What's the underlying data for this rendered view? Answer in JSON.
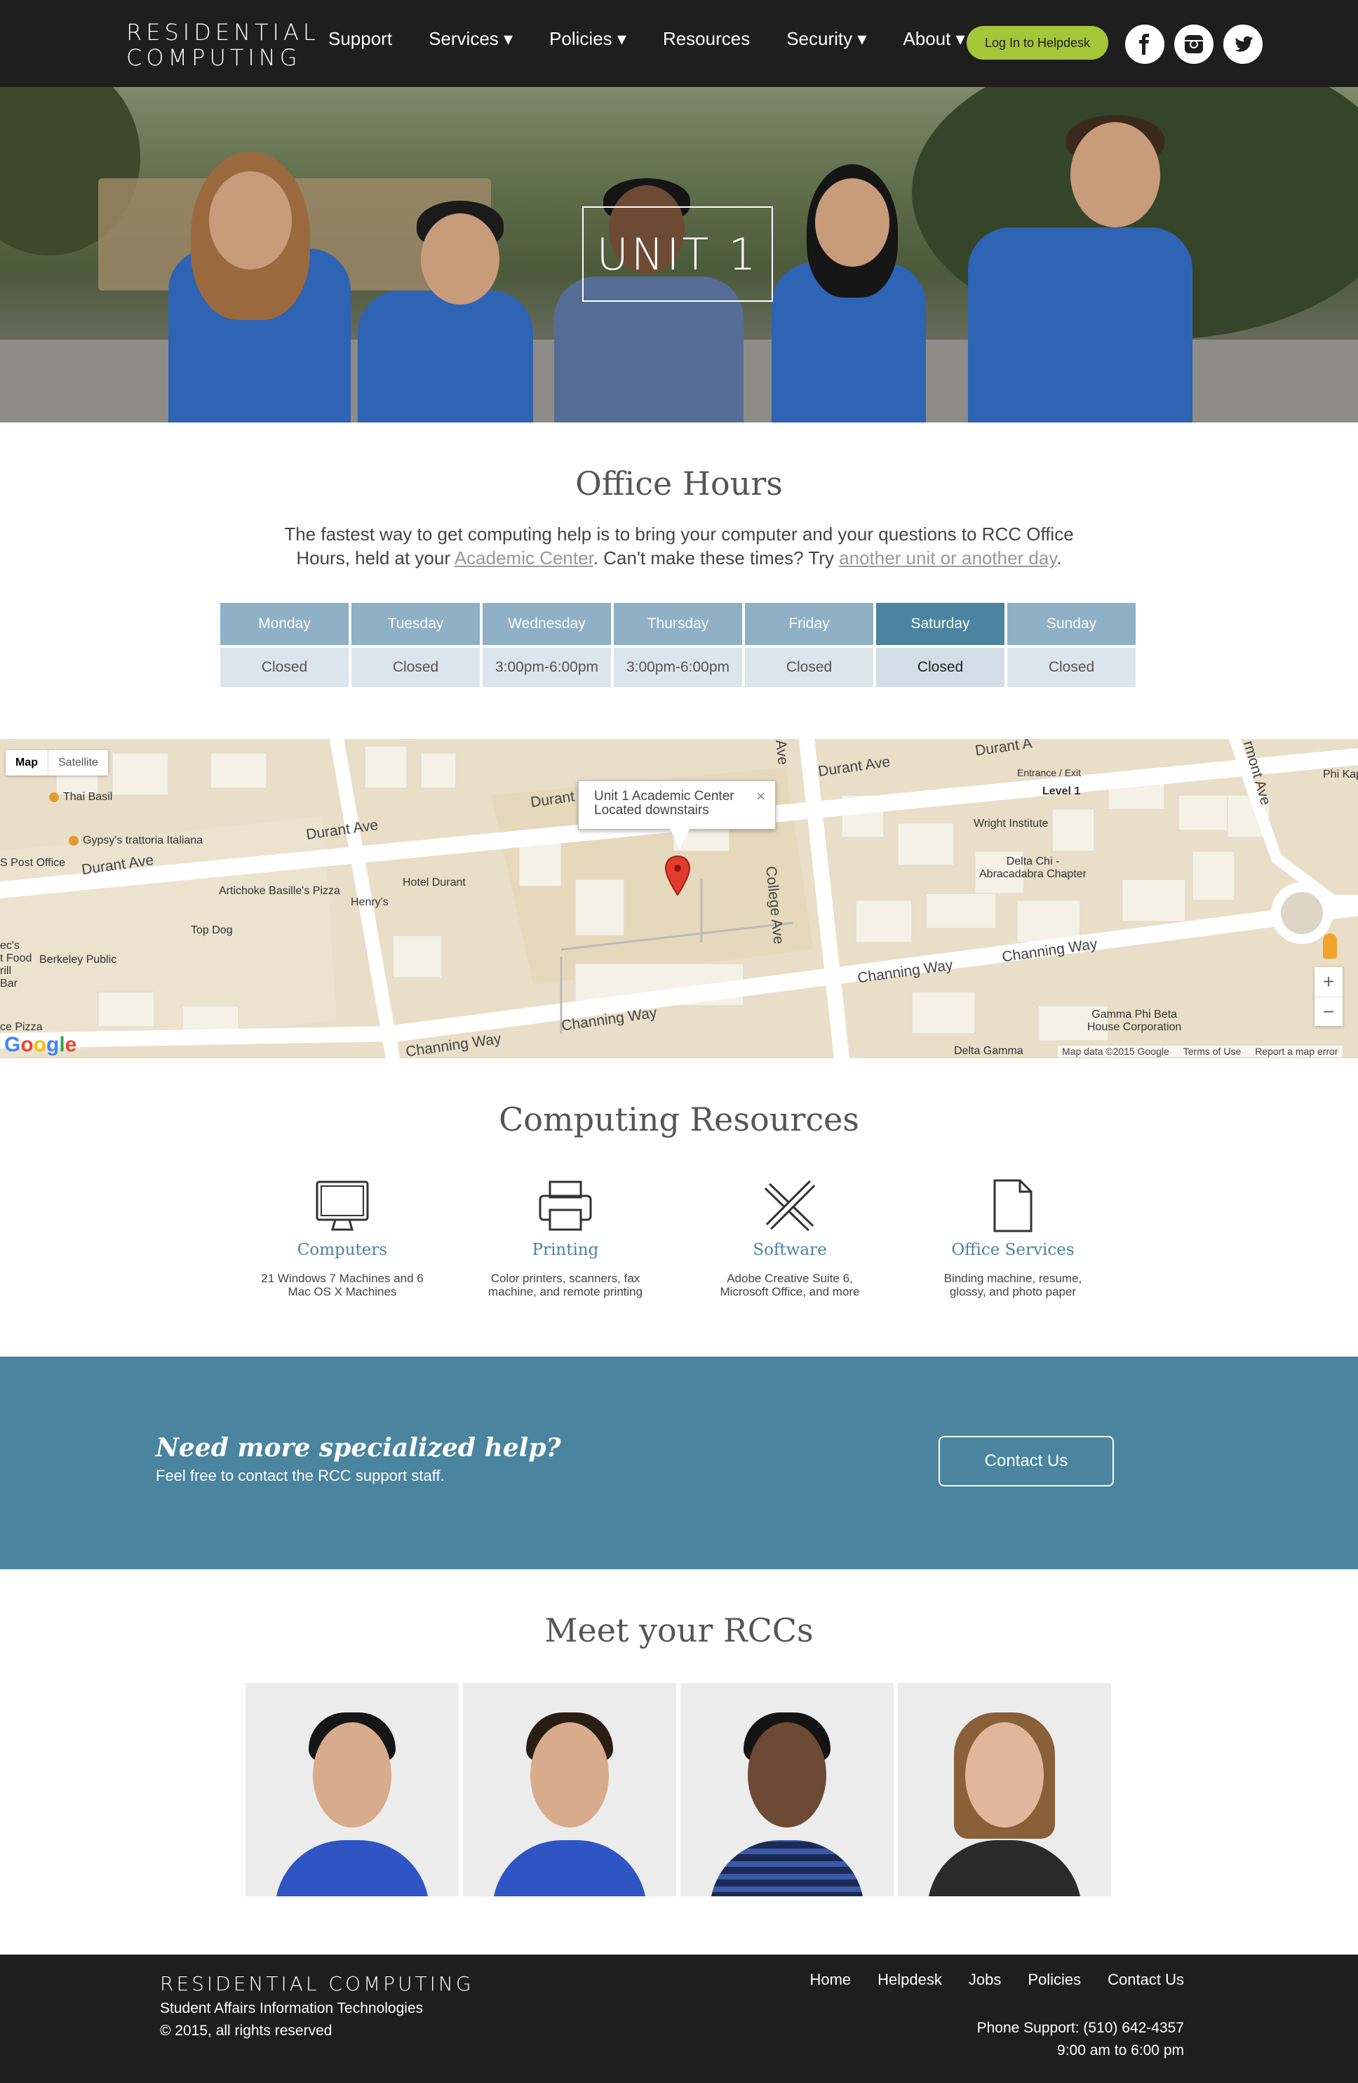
{
  "nav": {
    "logo_line1": "RESIDENTIAL",
    "logo_line2": "COMPUTING",
    "links": [
      "Support",
      "Services ▾",
      "Policies ▾",
      "Resources",
      "Security ▾",
      "About ▾"
    ],
    "helpdesk_label": "Log In to Helpdesk",
    "social": [
      "facebook-icon",
      "instagram-icon",
      "twitter-icon"
    ]
  },
  "hero": {
    "title": "UNIT 1"
  },
  "office_hours": {
    "title": "Office Hours",
    "desc_1": "The fastest way to get computing help is to bring your computer and your questions to RCC Office Hours, held at your ",
    "link_1": "Academic Center",
    "desc_2": ". Can't make these times? Try ",
    "link_2": "another unit or another day",
    "desc_3": ".",
    "days": [
      {
        "name": "Monday",
        "value": "Closed"
      },
      {
        "name": "Tuesday",
        "value": "Closed"
      },
      {
        "name": "Wednesday",
        "value": "3:00pm-6:00pm"
      },
      {
        "name": "Thursday",
        "value": "3:00pm-6:00pm"
      },
      {
        "name": "Friday",
        "value": "Closed"
      },
      {
        "name": "Saturday",
        "value": "Closed"
      },
      {
        "name": "Sunday",
        "value": "Closed"
      }
    ],
    "active_day": "Saturday"
  },
  "map": {
    "type_map": "Map",
    "type_satellite": "Satellite",
    "info_line1": "Unit 1 Academic Center",
    "info_line2": "Located downstairs",
    "close": "×",
    "zoom_in": "+",
    "zoom_out": "−",
    "google": "Google",
    "data_credit": "Map data ©2015 Google",
    "terms": "Terms of Use",
    "report": "Report a map error",
    "roads": {
      "durant_1": "Durant Ave",
      "durant_2": "Durant Ave",
      "durant_3": "Durant Ave",
      "durant_4": "Durant Ave",
      "durant_5": "Durant A",
      "college": "College Ave",
      "channing_1": "Channing Way",
      "channing_2": "Channing Way",
      "channing_3": "Channing Way",
      "channing_4": "Channing Way",
      "ave_top": "Ave",
      "bowditch": "rmont Ave"
    },
    "pois": {
      "thai_basil": "Thai Basil",
      "gypsys": "Gypsy's trattoria Italiana",
      "post_office": "S Post Office",
      "artichoke": "Artichoke Basille's Pizza",
      "henrys": "Henry's",
      "hotel_durant": "Hotel Durant",
      "top_dog": "Top Dog",
      "berkeley_public": "Berkeley Public",
      "ecs_food": "ec's\nt Food\nrill\nBar",
      "ce_pizza": "ce Pizza",
      "entrance": "Entrance / Exit",
      "level1": "Level 1",
      "wright": "Wright Institute",
      "delta_chi": "Delta Chi -\nAbracadabra Chapter",
      "gamma_phi": "Gamma Phi Beta\nHouse Corporation",
      "delta_gamma": "Delta Gamma",
      "phi_kap": "Phi Kap"
    }
  },
  "resources": {
    "title": "Computing Resources",
    "items": [
      {
        "title": "Computers",
        "desc_line1": "21 Windows 7 Machines and 6",
        "desc_line2": "Mac OS X Machines",
        "icon": "monitor-icon"
      },
      {
        "title": "Printing",
        "desc_line1": "Color printers, scanners, fax",
        "desc_line2": "machine, and remote printing",
        "icon": "printer-icon"
      },
      {
        "title": "Software",
        "desc_line1": "Adobe Creative Suite 6,",
        "desc_line2": "Microsoft Office, and more",
        "icon": "pencil-ruler-icon"
      },
      {
        "title": "Office Services",
        "desc_line1": "Binding machine, resume,",
        "desc_line2": "glossy, and photo paper",
        "icon": "document-icon"
      }
    ]
  },
  "cta": {
    "title": "Need more specialized help?",
    "subtitle": "Feel free to contact the RCC support staff.",
    "button": "Contact Us"
  },
  "rccs": {
    "title": "Meet your RCCs"
  },
  "footer": {
    "logo": "RESIDENTIAL COMPUTING",
    "org": "Student Affairs Information Technologies",
    "copyright": "© 2015, all rights reserved",
    "links": [
      "Home",
      "Helpdesk",
      "Jobs",
      "Policies",
      "Contact Us"
    ],
    "phone": "Phone Support: (510) 642-4357",
    "hours": "9:00 am to 6:00 pm"
  },
  "colors": {
    "nav_bg": "#1e1e1e",
    "helpdesk_green": "#a4c639",
    "accent_blue": "#4a849e",
    "day_header": "#8fb0c5",
    "day_header_active": "#4a84a0",
    "day_value": "#dbe5ec"
  }
}
